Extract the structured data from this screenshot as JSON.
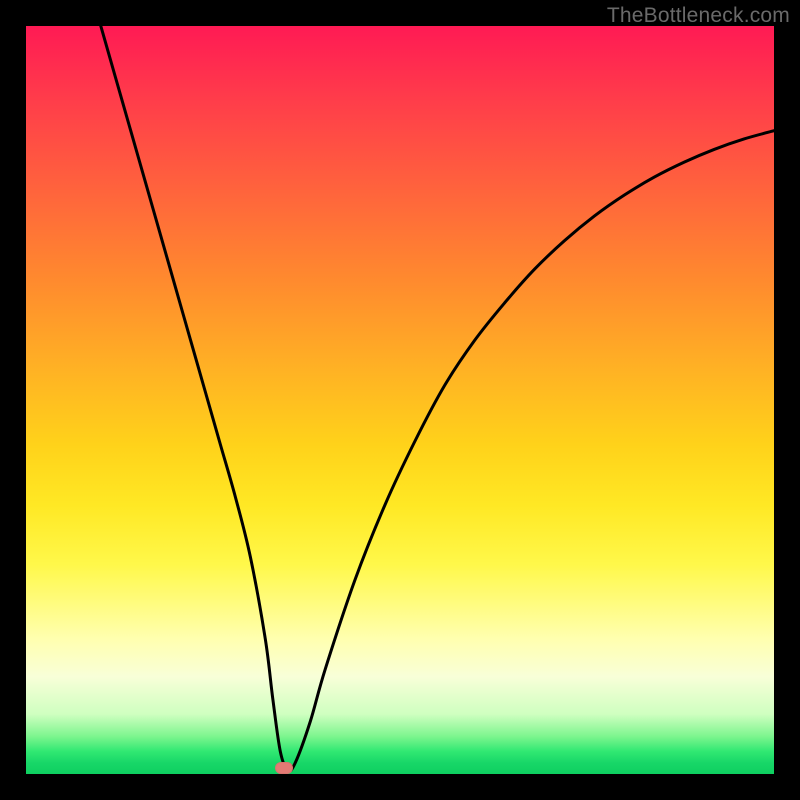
{
  "watermark": "TheBottleneck.com",
  "chart_data": {
    "type": "line",
    "title": "",
    "xlabel": "",
    "ylabel": "",
    "xlim": [
      0,
      100
    ],
    "ylim": [
      0,
      100
    ],
    "series": [
      {
        "name": "bottleneck-curve",
        "x": [
          10,
          12,
          14,
          16,
          18,
          20,
          22,
          24,
          26,
          28,
          30,
          32,
          33,
          34,
          35,
          36,
          38,
          40,
          44,
          48,
          52,
          56,
          60,
          64,
          68,
          72,
          76,
          80,
          84,
          88,
          92,
          96,
          100
        ],
        "values": [
          100,
          93,
          86,
          79,
          72,
          65,
          58,
          51,
          44,
          37,
          29,
          18,
          10,
          3,
          0.5,
          1.5,
          7,
          14,
          26,
          36,
          44.5,
          52,
          58,
          63,
          67.5,
          71.3,
          74.6,
          77.4,
          79.8,
          81.8,
          83.5,
          84.9,
          86
        ]
      }
    ],
    "marker": {
      "x": 34.5,
      "y": 0.8
    },
    "colors": {
      "curve": "#000000",
      "marker": "#e47a74",
      "gradient_top": "#ff1a54",
      "gradient_bottom": "#0ecf60"
    }
  }
}
